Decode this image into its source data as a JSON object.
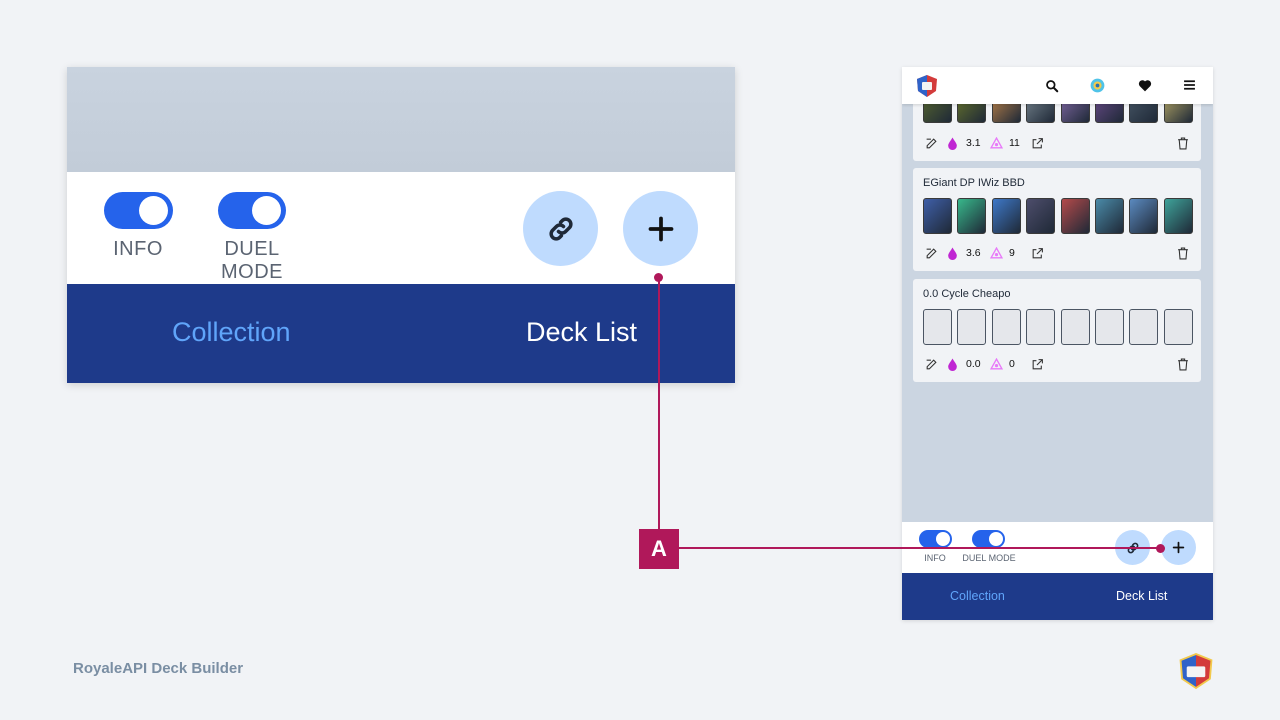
{
  "zoom_panel": {
    "toggles": [
      {
        "label": "INFO",
        "on": true
      },
      {
        "label": "DUEL MODE",
        "on": true
      }
    ],
    "link_icon": "link-icon",
    "add_icon": "plus-icon",
    "nav": {
      "collection": "Collection",
      "deck_list": "Deck List"
    }
  },
  "phone": {
    "header_icons": [
      "search-icon",
      "gem-icon",
      "heart-icon",
      "menu-icon"
    ],
    "decks": [
      {
        "name": "",
        "elixir": "3.1",
        "cycle": "11",
        "colors": [
          "#5c6b2e",
          "#6d7a2a",
          "#c98a4b",
          "#7d8c96",
          "#8a6fb0",
          "#6e4d8f",
          "#4a5a6a",
          "#c2b26a"
        ]
      },
      {
        "name": "EGiant DP IWiz BBD",
        "elixir": "3.6",
        "cycle": "9",
        "colors": [
          "#3f5fa8",
          "#38b88b",
          "#3e78c8",
          "#4d4d6b",
          "#b44a4a",
          "#4a8aa8",
          "#5b8ac0",
          "#3fa39a"
        ]
      },
      {
        "name": "0.0 Cycle Cheapo",
        "elixir": "0.0",
        "cycle": "0",
        "colors": []
      }
    ],
    "footer_toggles": [
      "INFO",
      "DUEL MODE"
    ],
    "nav": {
      "collection": "Collection",
      "deck_list": "Deck List"
    }
  },
  "callout": {
    "label": "A"
  },
  "brand": "RoyaleAPI Deck Builder",
  "colors": {
    "accent": "#2563eb",
    "navy": "#1e3a8a",
    "callout": "#b0185a",
    "light_blue": "#bfdbfe",
    "nav_active": "#60a5fa"
  }
}
